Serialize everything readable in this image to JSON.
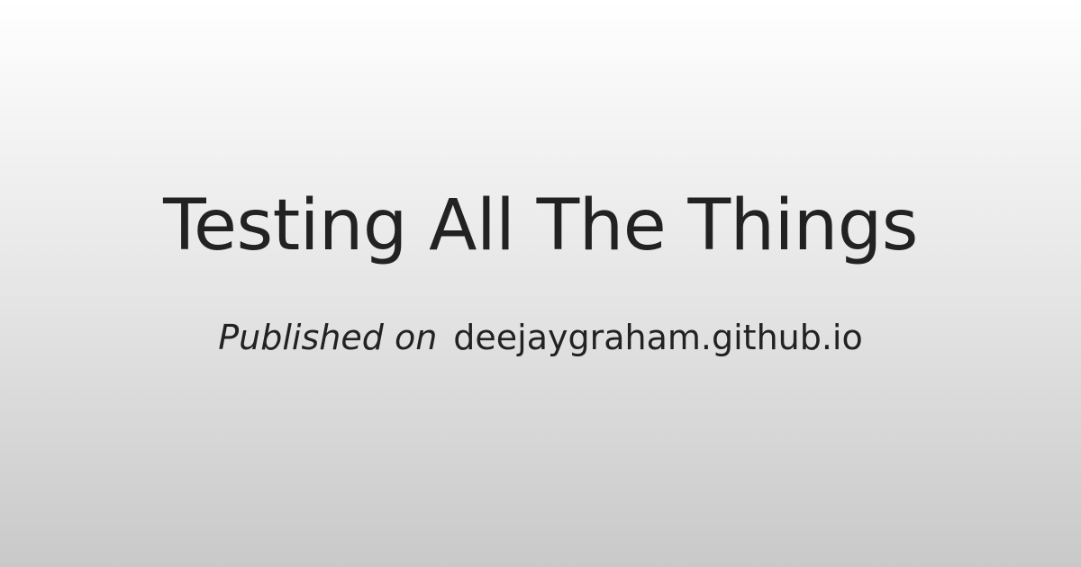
{
  "card": {
    "title": "Testing All The Things",
    "byline_prefix": "Published on",
    "byline_site": "deejaygraham.github.io"
  },
  "colors": {
    "text": "#222222",
    "gradient_top": "#ffffff",
    "gradient_bottom": "#c9c9c9"
  }
}
